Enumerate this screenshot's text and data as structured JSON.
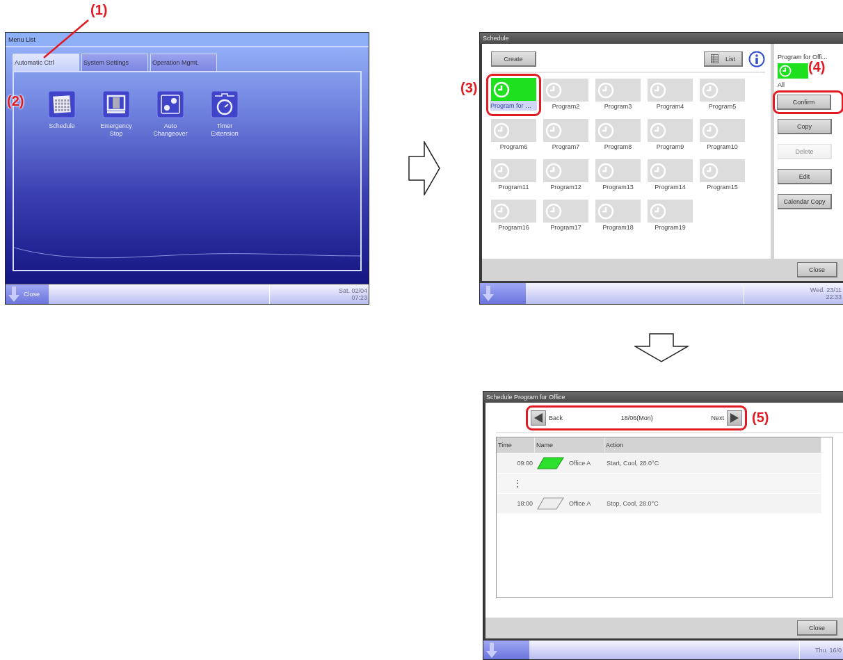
{
  "menu_list": {
    "title": "Menu List",
    "tabs": [
      {
        "label": "Automatic Ctrl",
        "selected": true,
        "callout": "(1)"
      },
      {
        "label": "System Settings",
        "selected": false
      },
      {
        "label": "Operation Mgmt.",
        "selected": false
      }
    ],
    "items": [
      {
        "label": "Schedule",
        "callout": "(2)"
      },
      {
        "label": "Emergency Stop"
      },
      {
        "label": "Auto Changeover"
      },
      {
        "label": "Timer Extension"
      }
    ],
    "footer": {
      "close": "Close",
      "date": "Sat. 02/04",
      "time": "07:23"
    }
  },
  "schedule": {
    "title": "Schedule",
    "create": "Create",
    "list": "List",
    "programs": [
      {
        "label": "Program for …",
        "selected": true,
        "callout": "(3)"
      },
      {
        "label": "Program2",
        "selected": false
      },
      {
        "label": "Program3",
        "selected": false
      },
      {
        "label": "Program4",
        "selected": false
      },
      {
        "label": "Program5",
        "selected": false
      },
      {
        "label": "Program6",
        "selected": false
      },
      {
        "label": "Program7",
        "selected": false
      },
      {
        "label": "Program8",
        "selected": false
      },
      {
        "label": "Program9",
        "selected": false
      },
      {
        "label": "Program10",
        "selected": false
      },
      {
        "label": "Program11",
        "selected": false
      },
      {
        "label": "Program12",
        "selected": false
      },
      {
        "label": "Program13",
        "selected": false
      },
      {
        "label": "Program14",
        "selected": false
      },
      {
        "label": "Program15",
        "selected": false
      },
      {
        "label": "Program16",
        "selected": false
      },
      {
        "label": "Program17",
        "selected": false
      },
      {
        "label": "Program18",
        "selected": false
      },
      {
        "label": "Program19",
        "selected": false
      }
    ],
    "side": {
      "name": "Program for Offi...",
      "group": "All",
      "buttons": [
        {
          "label": "Confirm",
          "disabled": false,
          "callout": "(4)"
        },
        {
          "label": "Copy",
          "disabled": false
        },
        {
          "label": "Delete",
          "disabled": true
        },
        {
          "label": "Edit",
          "disabled": false
        },
        {
          "label": "Calendar Copy",
          "disabled": false
        }
      ]
    },
    "close": "Close",
    "footer": {
      "date": "Wed. 23/11",
      "time": "22:33"
    }
  },
  "program_detail": {
    "title": "Schedule Program for Office",
    "nav": {
      "back": "Back",
      "date": "18/06(Mon)",
      "next": "Next",
      "callout": "(5)"
    },
    "columns": [
      "Time",
      "Name",
      "Action"
    ],
    "rows": [
      {
        "kind": "entry",
        "time": "09:00",
        "on": true,
        "name": "Office A",
        "action": "Start, Cool, 28.0°C"
      },
      {
        "kind": "gap",
        "time": "⋮"
      },
      {
        "kind": "entry",
        "time": "18:00",
        "on": false,
        "name": "Office A",
        "action": "Stop, Cool, 28.0°C"
      }
    ],
    "close": "Close",
    "footer": {
      "date": "Thu. 16/0"
    }
  }
}
